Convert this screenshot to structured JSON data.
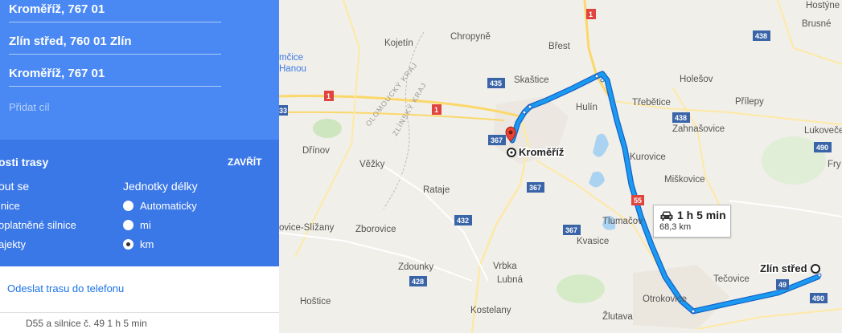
{
  "waypoints": [
    {
      "label": "Kroměříž, 767 01"
    },
    {
      "label": "Zlín střed, 760 01 Zlín"
    },
    {
      "label": "Kroměříž, 767 01"
    }
  ],
  "add_destination": "Přidat cíl",
  "options": {
    "title": "osti trasy",
    "close": "ZAVŘÍT",
    "avoid_heading": "out se",
    "units_heading": "Jednotky délky",
    "avoid_items": [
      "lnice",
      "oplatněné silnice",
      "ajekty"
    ],
    "units": [
      {
        "label": "Automaticky",
        "selected": false
      },
      {
        "label": "mi",
        "selected": false
      },
      {
        "label": "km",
        "selected": true
      }
    ]
  },
  "send_to_phone": "Odeslat trasu do telefonu",
  "bottom_text": "D55 a silnice č. 49                1 h 5 min",
  "map": {
    "places": [
      {
        "name": "Kojetín"
      },
      {
        "name": "Chropyně"
      },
      {
        "name": "Břest"
      },
      {
        "name": "Skaštice"
      },
      {
        "name": "Holešov"
      },
      {
        "name": "Přílepy"
      },
      {
        "name": "Hostýne"
      },
      {
        "name": "Brusné"
      },
      {
        "name": "Hulín"
      },
      {
        "name": "Třebětice"
      },
      {
        "name": "Zahnašovice"
      },
      {
        "name": "Lukoveče"
      },
      {
        "name": "Fry"
      },
      {
        "name": "Kurovice"
      },
      {
        "name": "Miškovice"
      },
      {
        "name": "Dřínov"
      },
      {
        "name": "Věžky"
      },
      {
        "name": "Rataje"
      },
      {
        "name": "Tlumačov"
      },
      {
        "name": "Kvasice"
      },
      {
        "name": "Zborovice"
      },
      {
        "name": "ovice-Slížany"
      },
      {
        "name": "Zdounky"
      },
      {
        "name": "Vrbka"
      },
      {
        "name": "Lubná"
      },
      {
        "name": "Otrokovice"
      },
      {
        "name": "Tečovice"
      },
      {
        "name": "Hoštice"
      },
      {
        "name": "Kostelany"
      },
      {
        "name": "Žlutava"
      },
      {
        "name": "mčice"
      },
      {
        "name": "Hanou"
      }
    ],
    "regions": [
      "OLOMOUCKÝ KRAJ",
      "ZLÍNSKÝ KRAJ"
    ],
    "road_shields": [
      "1",
      "1",
      "1",
      "435",
      "367",
      "367",
      "367",
      "432",
      "428",
      "55",
      "438",
      "438",
      "490",
      "490",
      "49",
      "33"
    ],
    "origin_label": "Kroměříž",
    "destination_label": "Zlín střed",
    "route_duration": "1 h 5 min",
    "route_distance": "68,3 km",
    "route_color": "#1a9af1"
  }
}
